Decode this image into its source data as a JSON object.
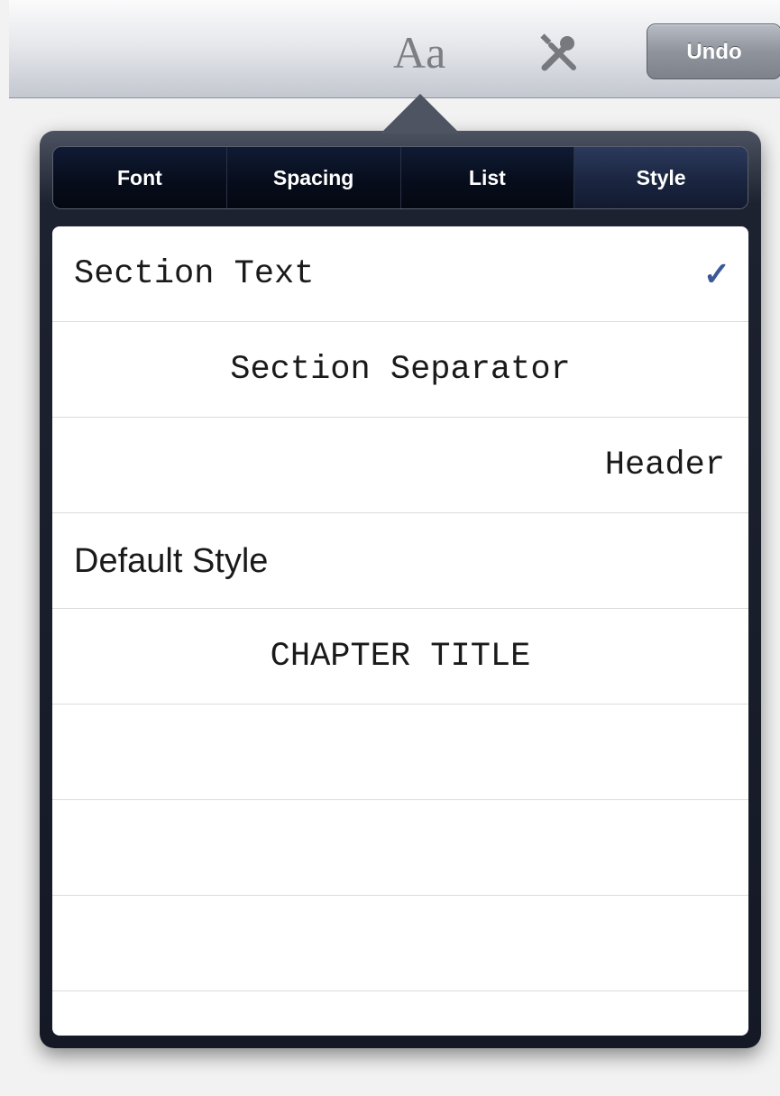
{
  "toolbar": {
    "font_icon_text": "Aa",
    "tools_icon": "wrench-screwdriver-icon",
    "undo_label": "Undo"
  },
  "tabs": [
    {
      "label": "Font",
      "selected": false
    },
    {
      "label": "Spacing",
      "selected": false
    },
    {
      "label": "List",
      "selected": false
    },
    {
      "label": "Style",
      "selected": true
    }
  ],
  "styles": [
    {
      "label": "Section Text",
      "checked": true
    },
    {
      "label": "Section Separator",
      "checked": false
    },
    {
      "label": "Header",
      "checked": false
    },
    {
      "label": "Default Style",
      "checked": false
    },
    {
      "label": "CHAPTER TITLE",
      "checked": false
    }
  ],
  "checkmark_glyph": "✓",
  "colors": {
    "checkmark": "#3b5998",
    "popover_background": "#141925",
    "selected_tab": "#1a2540"
  }
}
